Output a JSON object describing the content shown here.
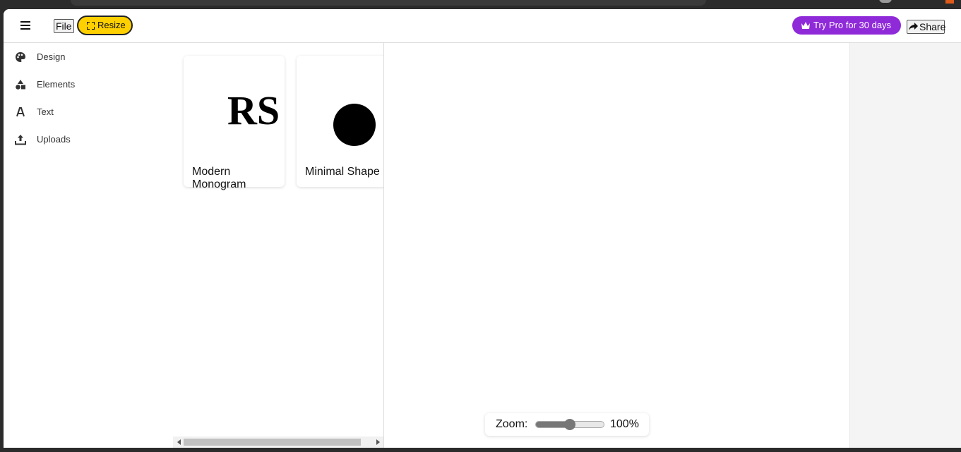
{
  "topbar": {
    "menu_icon": "hamburger-icon",
    "file_label": "File",
    "resize_label": "Resize",
    "resize_icon": "expand-icon",
    "pro_label": "Try Pro for 30 days",
    "pro_icon": "crown-icon",
    "share_label": "Share",
    "share_icon": "share-arrow-icon",
    "accent_yellow": "#ffd000",
    "accent_purple": "#8f2ad8"
  },
  "sidebar": {
    "items": [
      {
        "label": "Design",
        "icon": "palette-icon"
      },
      {
        "label": "Elements",
        "icon": "shapes-icon"
      },
      {
        "label": "Text",
        "icon": "text-icon"
      },
      {
        "label": "Uploads",
        "icon": "upload-icon"
      }
    ]
  },
  "templates": [
    {
      "title": "Modern Monogram",
      "preview_text": "RS"
    },
    {
      "title": "Minimal Shape",
      "preview_shape": "circle"
    }
  ],
  "zoom": {
    "label": "Zoom:",
    "value_text": "100%",
    "slider_fraction": 0.5
  }
}
